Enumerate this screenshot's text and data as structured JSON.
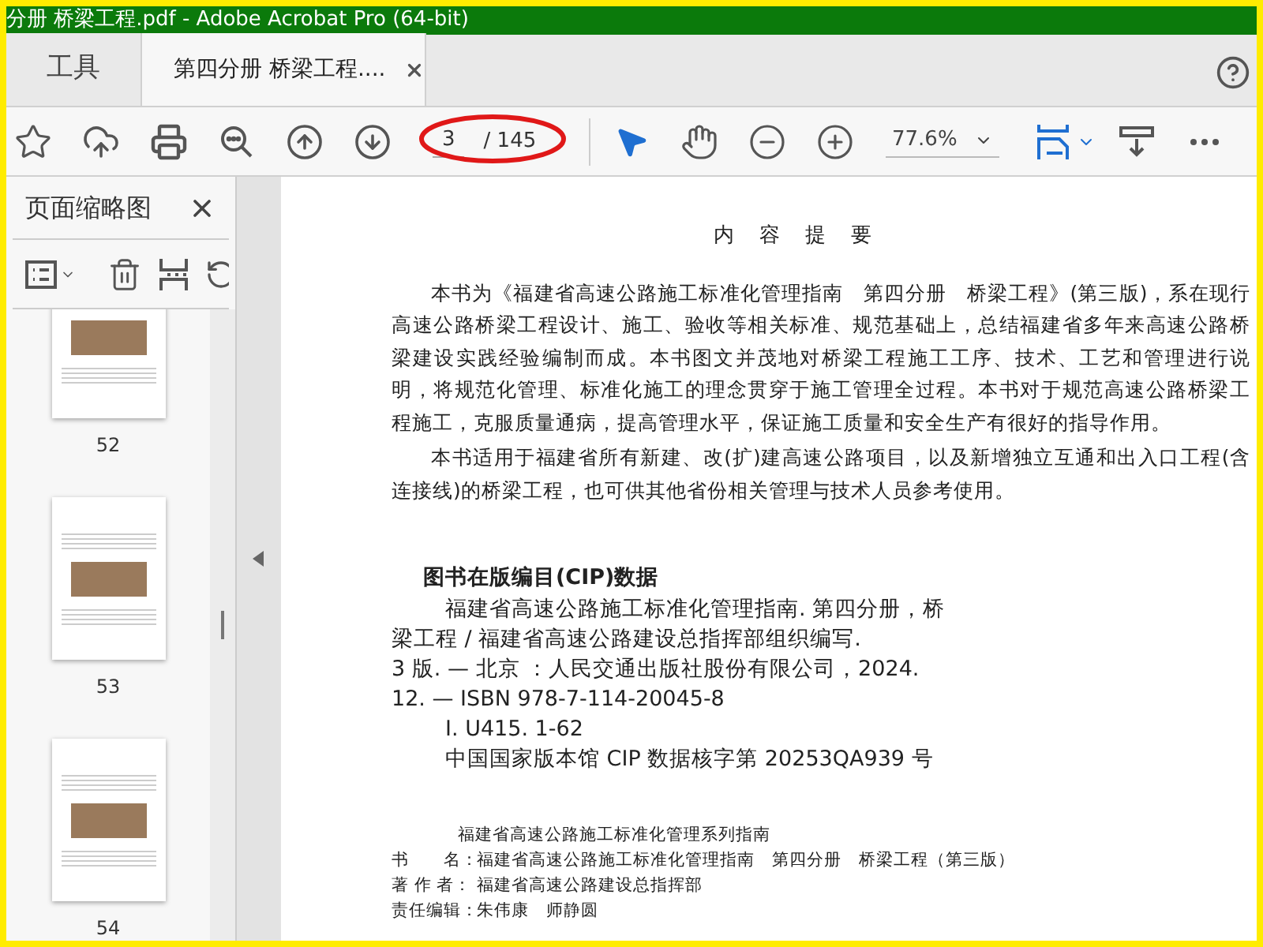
{
  "window": {
    "title": "分册 桥梁工程.pdf - Adobe Acrobat Pro (64-bit)"
  },
  "tabs": [
    {
      "label": "工具",
      "selected": false,
      "closable": false
    },
    {
      "label": "第四分册 桥梁工程....",
      "selected": true,
      "closable": true
    }
  ],
  "toolbar": {
    "page_current": "3",
    "page_total": "/ 145",
    "zoom": "77.6%"
  },
  "sidebar": {
    "title": "页面缩略图",
    "thumbnails": [
      {
        "page": "52"
      },
      {
        "page": "53"
      },
      {
        "page": "54"
      }
    ]
  },
  "document": {
    "heading": "内 容 提 要",
    "intro": [
      "本书为《福建省高速公路施工标准化管理指南　第四分册　桥梁工程》(第三版)，系在现行高速公路桥梁工程设计、施工、验收等相关标准、规范基础上，总结福建省多年来高速公路桥梁建设实践经验编制而成。本书图文并茂地对桥梁工程施工工序、技术、工艺和管理进行说明，将规范化管理、标准化施工的理念贯穿于施工管理全过程。本书对于规范高速公路桥梁工程施工，克服质量通病，提高管理水平，保证施工质量和安全生产有很好的指导作用。",
      "本书适用于福建省所有新建、改(扩)建高速公路项目，以及新增独立互通和出入口工程(含连接线)的桥梁工程，也可供其他省份相关管理与技术人员参考使用。"
    ],
    "cip_heading": "图书在版编目(CIP)数据",
    "cip_lines": [
      {
        "text": "福建省高速公路施工标准化管理指南. 第四分册，桥",
        "indent": true
      },
      {
        "text": "梁工程 / 福建省高速公路建设总指挥部组织编写.",
        "indent": false
      },
      {
        "text": "3 版. — 北京 ：人民交通出版社股份有限公司，2024.",
        "indent": false
      },
      {
        "text": "12. — ISBN  978-7-114-20045-8",
        "indent": false
      },
      {
        "text": "Ⅰ. U415. 1-62",
        "indent": true
      },
      {
        "text": "中国国家版本馆 CIP 数据核字第 20253QA939 号",
        "indent": true
      }
    ],
    "series": "福建省高速公路施工标准化管理系列指南",
    "imprint": [
      {
        "label": "书　　名：",
        "value": "福建省高速公路施工标准化管理指南　第四分册　桥梁工程（第三版）"
      },
      {
        "label": "著 作 者：",
        "value": "福建省高速公路建设总指挥部"
      },
      {
        "label": "责任编辑：",
        "value": "朱伟康　师静圆"
      }
    ]
  }
}
